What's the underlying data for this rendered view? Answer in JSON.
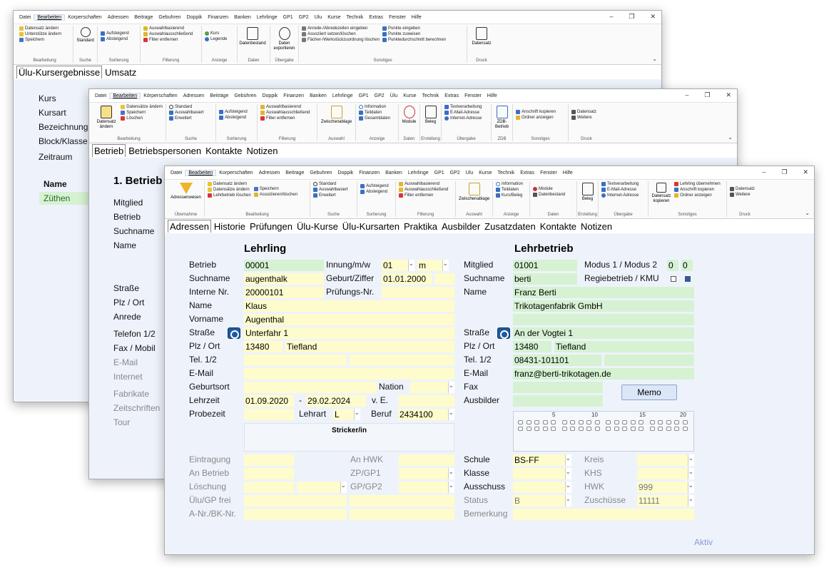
{
  "win1": {
    "menu": [
      "Datei",
      "Bearbeiten",
      "Korperschaften",
      "Adressen",
      "Beitrage",
      "Gebuhren",
      "Doppik",
      "Finanzen",
      "Banken",
      "Lehrlinge",
      "GP1",
      "GP2",
      "Ulu",
      "Kurse",
      "Technik",
      "Extras",
      "Fenster",
      "Hilfe"
    ],
    "ribbon": {
      "edit": [
        "Datensatz ändern",
        "Unterstütze ändern",
        "Speichern"
      ],
      "edit_label": "Bearbeitung",
      "search_big": "Standard",
      "search_label": "Suche",
      "sort": [
        "Aufsteigend",
        "Absteigend"
      ],
      "sort_label": "Sortierung",
      "filter": [
        "Auswahlbasierend",
        "Auswahlausschließend",
        "Filter entfernen"
      ],
      "filter_label": "Filterung",
      "view": [
        "Kurs",
        "Legende"
      ],
      "view_label": "Anzeige",
      "data_big": "Datenbestand",
      "data_label": "Daten",
      "export_big": "Daten exportieren",
      "export_label": "Übergabe",
      "misc": [
        "Anrede-/Abredezeilen eingeben",
        "Assoziiert setzen/löschen",
        "Fächer-/Werkstückzuordnung löschen",
        "Punkte eingeben",
        "Punkte zuweisen",
        "Punktedurchschnitt berechnen"
      ],
      "misc_label": "Sonstiges",
      "print_big": "Datensatz",
      "print_label": "Druck"
    },
    "tabs": [
      "Ülu-Kursergebnisse",
      "Umsatz"
    ],
    "labels": [
      "Kurs",
      "Kursart",
      "Bezeichnung",
      "Block/Klasse",
      "Zeitraum"
    ],
    "table_header": "Name",
    "table_row": "Züthen"
  },
  "win2": {
    "menu": [
      "Datei",
      "Bearbeiten",
      "Körperschaften",
      "Adressen",
      "Beiträge",
      "Gebühren",
      "Doppik",
      "Finanzen",
      "Banken",
      "Lehrlinge",
      "GP1",
      "GP2",
      "Ülu",
      "Kurse",
      "Technik",
      "Extras",
      "Fenster",
      "Hilfe"
    ],
    "ribbon": {
      "edit_big": "Datensatz ändern",
      "edit": [
        "Datensätze ändern",
        "Speichern",
        "Löschen"
      ],
      "edit_label": "Bearbeitung",
      "search": [
        "Standard",
        "Auswahlbasiert",
        "Erweitert"
      ],
      "search_label": "Suche",
      "sort": [
        "Aufsteigend",
        "Absteigend"
      ],
      "sort_label": "Sortierung",
      "filter": [
        "Auswahlbasierend",
        "Auswahlausschließend",
        "Filter entfernen"
      ],
      "filter_label": "Filterung",
      "select_big": "Zwischenablage",
      "select_label": "Auswahl",
      "view": [
        "Information",
        "Teildaten",
        "Gesamtdaten"
      ],
      "view_label": "Anzeige",
      "data_big": "Module",
      "data_label": "Daten",
      "create_big": "Beleg",
      "create_label": "Erstellung",
      "transfer": [
        "Textverarbeitung",
        "E-Mail-Adresse",
        "Internet-Adresse"
      ],
      "transfer_label": "Übergabe",
      "zdb_big": "ZDB-Betrieb",
      "zdb_label": "ZDB",
      "misc": [
        "Anschrift kopieren",
        "Ordner anzeigen"
      ],
      "misc_label": "Sonstiges",
      "print": [
        "Datensatz",
        "Weitere"
      ],
      "print_label": "Druck"
    },
    "tabs": [
      "Betrieb",
      "Betriebspersonen",
      "Kontakte",
      "Notizen"
    ],
    "heading": "1. Betrieb",
    "labels_top": [
      "Mitglied",
      "Betrieb",
      "Suchname",
      "Name"
    ],
    "labels_mid": [
      "Straße",
      "Plz / Ort",
      "Anrede"
    ],
    "labels_low": [
      "Telefon 1/2",
      "Fax / Mobil",
      "E-Mail",
      "Internet"
    ],
    "labels_bottom": [
      "Fabrikate",
      "Zeitschriften",
      "Tour"
    ]
  },
  "win3": {
    "menu": [
      "Datei",
      "Bearbeiten",
      "Korperschaften",
      "Adressen",
      "Beitrage",
      "Gebuhren",
      "Doppik",
      "Finanzen",
      "Banken",
      "Lehrlinge",
      "GP1",
      "GP2",
      "Ulu",
      "Kurse",
      "Technik",
      "Extras",
      "Fenster",
      "Hilfe"
    ],
    "ribbon": {
      "uber_big": "Adressenwesen",
      "uber_label": "Übernahme",
      "edit": [
        "Datensatz ändern",
        "Datensätze ändern",
        "Lehrbetrieb löschen",
        "Speichern",
        "Assoziieren/löschen"
      ],
      "edit_label": "Bearbeitung",
      "search": [
        "Standard",
        "Auswahlbasiert",
        "Erweitert"
      ],
      "search_label": "Suche",
      "sort": [
        "Aufsteigend",
        "Absteigend"
      ],
      "sort_label": "Sortierung",
      "filter": [
        "Auswahlbasierend",
        "Auswahlausschließend",
        "Filter entfernen"
      ],
      "filter_label": "Filterung",
      "select_big": "Zwischenablage",
      "select_label": "Auswahl",
      "view": [
        "Information",
        "Teildaten",
        "Kurs/Beleg"
      ],
      "view_label": "Anzeige",
      "data": [
        "Module",
        "Datenbestand"
      ],
      "data_label": "Daten",
      "create_big": "Beleg",
      "create_label": "Erstellung",
      "transfer": [
        "Textverarbeitung",
        "E-Mail-Adresse",
        "Internet-Adresse"
      ],
      "transfer_label": "Übergabe",
      "copy_big": "Datensatz kopieren",
      "misc": [
        "Lehrling übernehmen",
        "Anschrift kopieren",
        "Ordner anzeigen"
      ],
      "misc_label": "Sonstiges",
      "print": [
        "Datensatz",
        "Weitere"
      ],
      "print_label": "Druck"
    },
    "tabs": [
      "Adressen",
      "Historie",
      "Prüfungen",
      "Ülu-Kurse",
      "Ülu-Kursarten",
      "Praktika",
      "Ausbilder",
      "Zusatzdaten",
      "Kontakte",
      "Notizen"
    ],
    "lehrling": {
      "heading": "Lehrling",
      "betrieb_label": "Betrieb",
      "betrieb": "00001",
      "suchname_label": "Suchname",
      "suchname": "augenthalk",
      "interne_label": "Interne Nr.",
      "interne": "20000101",
      "name_label": "Name",
      "name": "Klaus",
      "vorname_label": "Vorname",
      "vorname": "Augenthal",
      "strasse_label": "Straße",
      "strasse": "Unterfahr 1",
      "plz_label": "Plz / Ort",
      "plz": "13480",
      "ort": "Tiefland",
      "tel_label": "Tel. 1/2",
      "email_label": "E-Mail",
      "geburtsort_label": "Geburtsort",
      "nation_label": "Nation",
      "lehrzeit_label": "Lehrzeit",
      "lehrzeit_von": "01.09.2020",
      "lehrzeit_sep": "-",
      "lehrzeit_bis": "29.02.2024",
      "ve_label": "v. E.",
      "probezeit_label": "Probezeit",
      "lehrart_label": "Lehrart",
      "lehrart": "L",
      "beruf_label": "Beruf",
      "beruf": "2434100",
      "beruf_name": "Stricker/in",
      "innung_label": "Innung/m/w",
      "innung": "01",
      "geschlecht": "m",
      "geburt_label": "Geburt/Ziffer",
      "geburt": "01.01.2000",
      "pruef_label": "Prüfungs-Nr."
    },
    "lehrbetrieb": {
      "heading": "Lehrbetrieb",
      "mitglied_label": "Mitglied",
      "mitglied": "01001",
      "modus_label": "Modus 1 / Modus 2",
      "modus1": "0",
      "modus2": "0",
      "suchname_label": "Suchname",
      "suchname": "berti",
      "regie_label": "Regiebetrieb / KMU",
      "name_label": "Name",
      "name1": "Franz Berti",
      "name2": "Trikotagenfabrik GmbH",
      "strasse_label": "Straße",
      "strasse": "An der Vogtei 1",
      "plz_label": "Plz / Ort",
      "plz": "13480",
      "ort": "Tiefland",
      "tel_label": "Tel. 1/2",
      "tel": "08431-101101",
      "email_label": "E-Mail",
      "email": "franz@berti-trikotagen.de",
      "fax_label": "Fax",
      "ausbilder_label": "Ausbilder",
      "memo": "Memo",
      "grid_nums": [
        "5",
        "10",
        "15",
        "20"
      ]
    },
    "bottom_left": [
      "Eintragung",
      "An Betrieb",
      "Löschung",
      "Ülu/GP frei",
      "A-Nr./BK-Nr."
    ],
    "bottom_mid": [
      "An HWK",
      "ZP/GP1",
      "GP/GP2"
    ],
    "bottom_right": {
      "schule_label": "Schule",
      "schule": "BS-FF",
      "klasse_label": "Klasse",
      "ausschuss_label": "Ausschuss",
      "status_label": "Status",
      "status": "B",
      "bemerkung_label": "Bemerkung",
      "kreis_label": "Kreis",
      "khs_label": "KHS",
      "hwk_label": "HWK",
      "hwk": "999",
      "zuschuesse_label": "Zuschüsse",
      "zuschuesse": "11111"
    },
    "status_text": "Aktiv"
  }
}
